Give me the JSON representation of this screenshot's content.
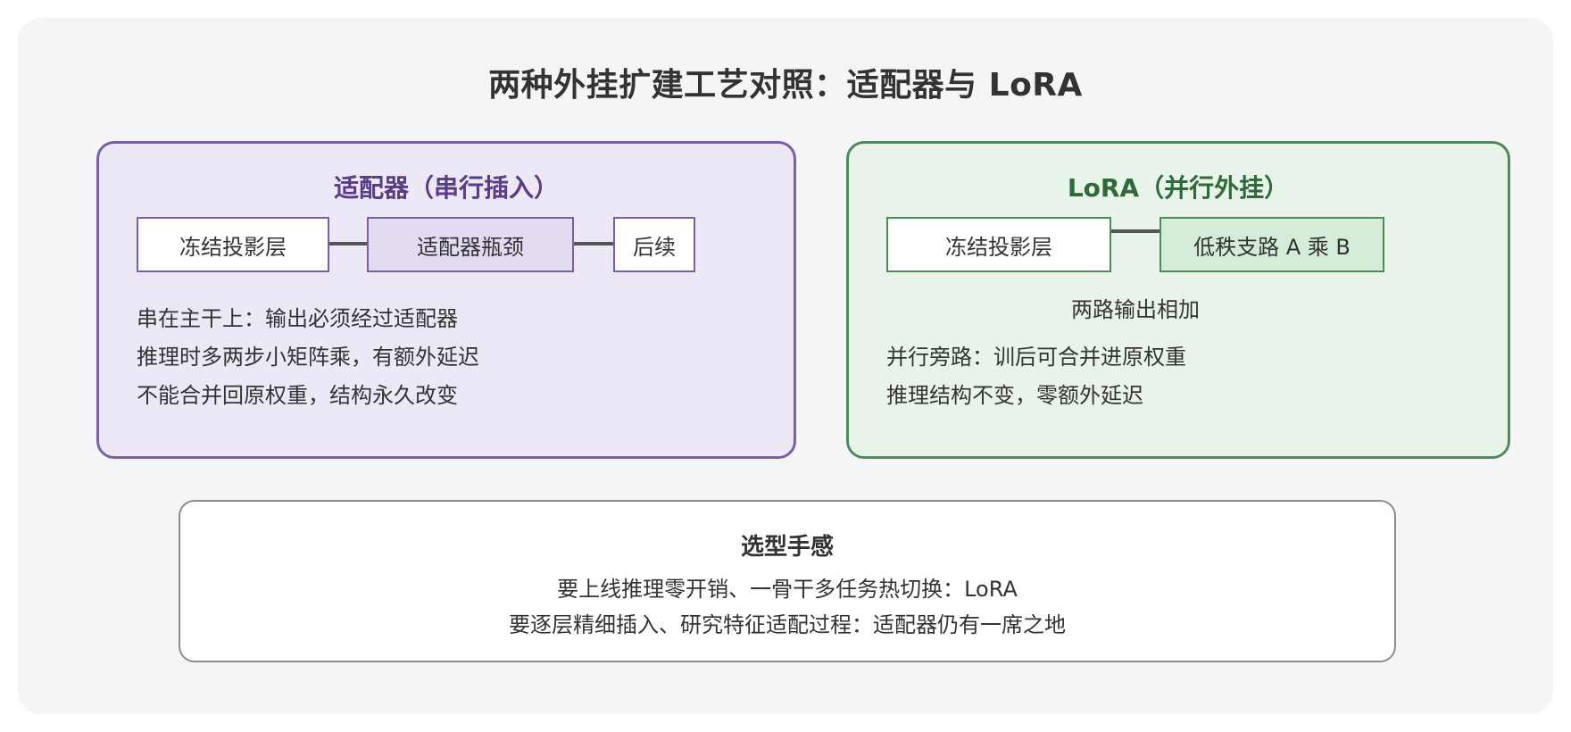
{
  "title": "两种外挂扩建工艺对照：适配器与 LoRA",
  "adapter": {
    "title": "适配器（串行插入）",
    "boxes": {
      "frozen": "冻结投影层",
      "bottleneck": "适配器瓶颈",
      "next": "后续"
    },
    "bullets": [
      "串在主干上：输出必须经过适配器",
      "推理时多两步小矩阵乘，有额外延迟",
      "不能合并回原权重，结构永久改变"
    ]
  },
  "lora": {
    "title": "LoRA（并行外挂）",
    "boxes": {
      "frozen": "冻结投影层",
      "branch": "低秩支路 A 乘 B"
    },
    "merge_note": "两路输出相加",
    "bullets": [
      "并行旁路：训后可合并进原权重",
      "推理结构不变，零额外延迟"
    ]
  },
  "summary": {
    "title": "选型手感",
    "lines": [
      "要上线推理零开销、一骨干多任务热切换：LoRA",
      "要逐层精细插入、研究特征适配过程：适配器仍有一席之地"
    ]
  },
  "colors": {
    "adapter_border": "#7d5ca8",
    "adapter_fill": "#ede8f6",
    "lora_border": "#4f8a5c",
    "lora_fill": "#e8f4ea",
    "background": "#f4f5f7"
  }
}
